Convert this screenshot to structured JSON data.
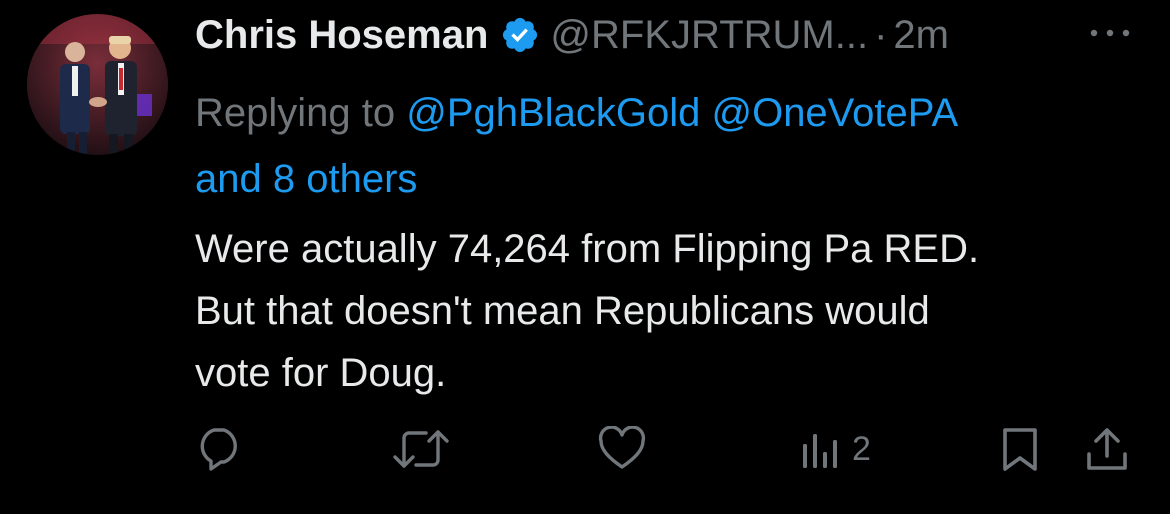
{
  "tweet": {
    "author_name": "Chris Hoseman",
    "author_handle": "@RFKJRTRUM...",
    "separator": "·",
    "timestamp": "2m",
    "replying_prefix": "Replying to",
    "mention_1": "@PghBlackGold",
    "mention_2": "@OneVotePA",
    "mention_others": "and 8 others",
    "body_lines": [
      "Were actually 74,264 from Flipping Pa RED.",
      "But that doesn't mean Republicans would",
      "vote for Doug."
    ],
    "views_count": "2"
  },
  "icons": {
    "avatar": "avatar-photo",
    "verified": "verified-badge-icon",
    "more": "more-dots-icon",
    "reply": "reply-icon",
    "retweet": "retweet-icon",
    "like": "heart-icon",
    "views": "views-chart-icon",
    "bookmark": "bookmark-icon",
    "share": "share-icon"
  },
  "colors": {
    "background": "#000000",
    "text_primary": "#e7e9ea",
    "text_secondary": "#71767b",
    "accent": "#1d9bf0"
  }
}
